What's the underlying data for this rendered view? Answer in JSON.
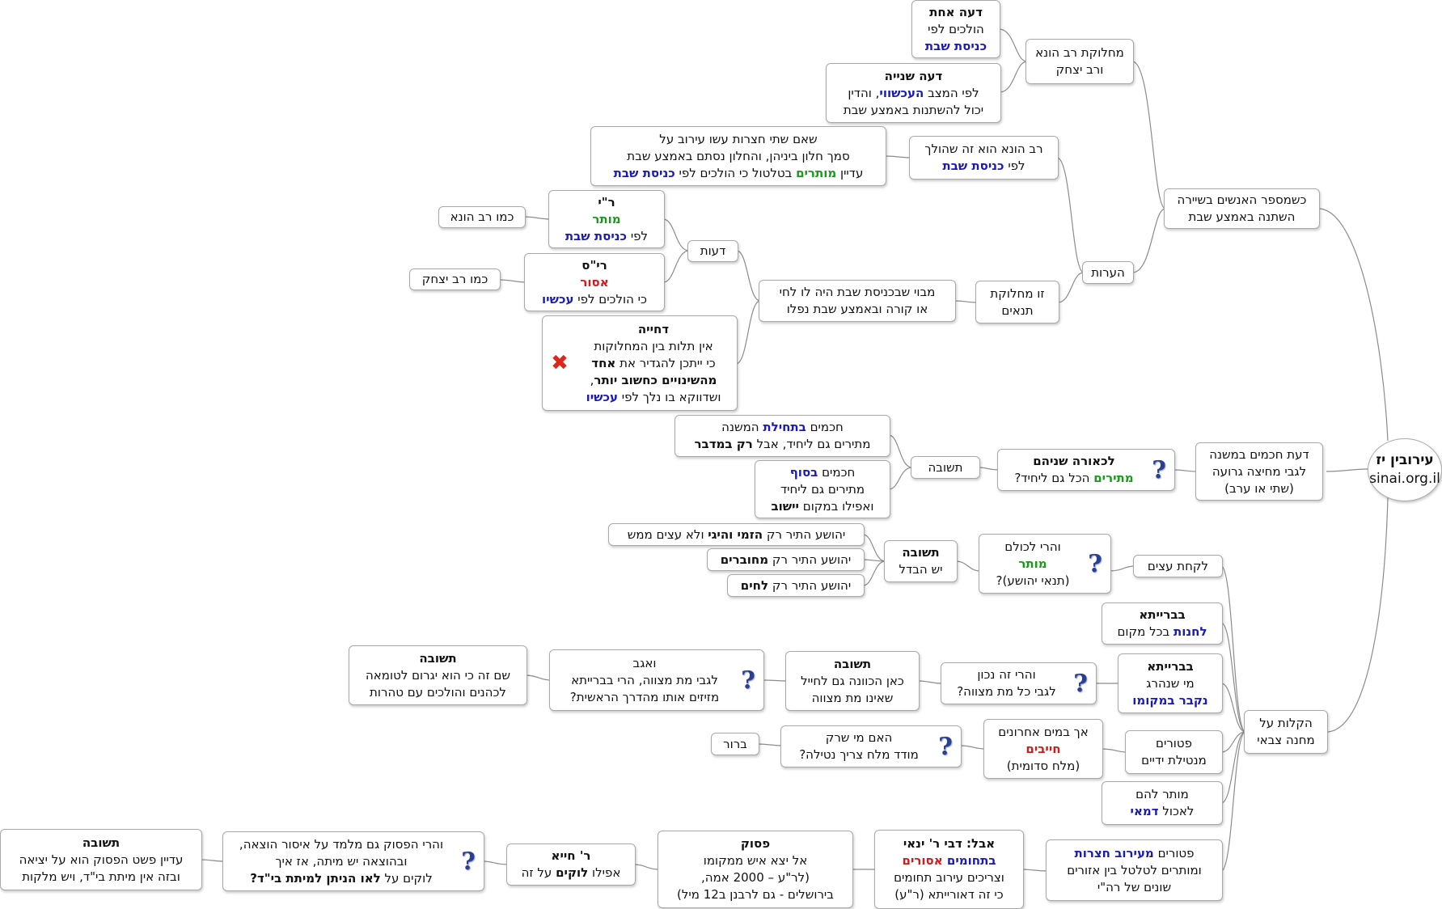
{
  "root": {
    "title": "עירובין יז",
    "site": "sinai.org.il"
  },
  "branch_change": {
    "l1": "כשמספר האנשים בשיירה",
    "l2": "השתנה באמצע שבת"
  },
  "dispute": {
    "l1": "מחלוקת רב הונא",
    "l2": "ורב יצחק"
  },
  "opinion1": {
    "title": "דעה אחת",
    "l1": "הולכים לפי",
    "l2": "כניסת שבת"
  },
  "opinion2": {
    "title": "דעה שנייה",
    "l1a": "לפי המצב ",
    "l1b": "העכשווי",
    "l1c": ", והדין",
    "l2": "יכול להשתנות באמצע שבת"
  },
  "huna": {
    "l1": "רב הונא הוא זה שהולך",
    "l2a": "לפי ",
    "l2b": "כניסת שבת"
  },
  "courtyards": {
    "l1": "שאם שתי חצרות עשו עירוב על",
    "l2": "סמך חלון ביניהן, והחלון נסתם באמצע שבת",
    "l3a": "עדיין ",
    "l3b": "מותרים",
    "l3c": "  בטלטול כי הולכים לפי ",
    "l3d": "כניסת שבת"
  },
  "notes": {
    "label": "הערות"
  },
  "tannaim": {
    "l1": "זו מחלוקת",
    "l2": "תנאים"
  },
  "alley": {
    "l1": "מבוי שבכניסת שבת היה לו לחי",
    "l2": "או קורה ובאמצע שבת נפלו"
  },
  "views": {
    "label": "דעות"
  },
  "ry": {
    "title": "ר\"י",
    "l1": "מותר",
    "l2a": "לפי ",
    "l2b": "כניסת שבת"
  },
  "like_huna": {
    "label": "כמו רב הונא"
  },
  "ris": {
    "title": "רי\"ס",
    "l1": "אסור",
    "l2a": "כי הולכים לפי ",
    "l2b": "עכשיו"
  },
  "like_yitzchak": {
    "label": "כמו רב יצחק"
  },
  "rejection": {
    "title": "דחייה",
    "l1": "אין תלות בין המחלוקות",
    "l2a": "כי ייתכן להגדיר את ",
    "l2b": "אחד",
    "l3": "מהשינויים כחשוב יותר",
    "l3c": ",",
    "l4a": "ושדווקא בו נלך לפי ",
    "l4b": "עכשיו",
    "icon": "red-x-icon"
  },
  "sages": {
    "l1": "דעת חכמים במשנה",
    "l2": "לגבי מחיצה גרועה",
    "l3": "(שתי או ערב)"
  },
  "seemingly": {
    "title": "לכאורה שניהם",
    "l1a": "מתירים",
    "l1b": " הכל גם ליחיד?",
    "icon": "question-icon"
  },
  "answer1": {
    "label": "תשובה"
  },
  "sages_start": {
    "l1a": "חכמים ",
    "l1b": "בתחילת",
    "l1c": "  המשנה",
    "l2a": "מתירים גם ליחיד, אבל ",
    "l2b": "רק במדבר"
  },
  "sages_end": {
    "l1a": "חכמים ",
    "l1b": "בסוף",
    "l2": "מתירים גם ליחיד",
    "l3a": "ואפילו במקום ",
    "l3b": "יישוב"
  },
  "wood": {
    "label": "לקחת עצים"
  },
  "allowed_all": {
    "l1": "והרי לכולם",
    "l2": "מותר",
    "l3": "(תנאי יהושע)?",
    "icon": "question-icon"
  },
  "answer2": {
    "title": "תשובה",
    "l1": "יש הבדל"
  },
  "yehoshua1": {
    "a": "יהושע התיר רק ",
    "b": "הזמי והיגי",
    "c": " ולא עצים ממש"
  },
  "yehoshua2": {
    "a": "יהושע התיר רק ",
    "b": "מחוברים"
  },
  "yehoshua3": {
    "a": "יהושע התיר רק ",
    "b": "לחים"
  },
  "leniencies": {
    "l1": "הקלות על",
    "l2": "מחנה צבאי"
  },
  "baraita1": {
    "title": "בברייתא",
    "l1a": "לחנות",
    "l1b": " בכל מקום"
  },
  "baraita2": {
    "title": "בברייתא",
    "l1": "מי שנהרג",
    "l2": "נקבר במקומו"
  },
  "met_mitzva": {
    "l1": "והרי זה נכון",
    "l2": "לגבי כל מת מצווה?",
    "icon": "question-icon"
  },
  "answer3": {
    "title": "תשובה",
    "l1": "כאן הכוונה גם לחייל",
    "l2": "שאינו מת מצווה"
  },
  "incidentally": {
    "l1": "ואגב",
    "l2": "לגבי מת מצווה, הרי בברייתא",
    "l3": "מזיזים אותו מהדרך הראשית?",
    "icon": "question-icon"
  },
  "answer4": {
    "title": "תשובה",
    "l1": "שם זה כי הוא יגרום לטומאה",
    "l2": "לכהנים והולכים עם טהרות"
  },
  "handwash": {
    "l1": "פטורים",
    "l2": "מנטילת ידיים"
  },
  "mayim": {
    "l1": "אך במים אחרונים",
    "l2": "חייבים",
    "l3": "(מלח סדומית)"
  },
  "salt": {
    "l1": "האם מי שרק",
    "l2": "מודד מלח צריך נטילה?",
    "icon": "question-icon"
  },
  "clear": {
    "label": "ברור"
  },
  "demai": {
    "l1": "מותר להם",
    "l2a": "לאכול ",
    "l2b": "דמאי"
  },
  "eruv_exempt": {
    "l1a": "פטורים ",
    "l1b": "מעירוב חצרות",
    "l2": "ומותרים לטלטל בין אזורים",
    "l3": "שונים של רה\"י"
  },
  "but_yannai": {
    "title": "אבל: דבי ר' ינאי",
    "l1a": "בתחומים",
    "l1b": " אסורים",
    "l2": "וצריכים עירוב תחומים",
    "l3": "כי זה דאורייתא (ר\"ע)"
  },
  "verse": {
    "title": "פסוק",
    "l1": "אל יצא איש ממקומו",
    "l2": "(לר\"ע – 2000 אמה,",
    "l3": "בירושלים - גם לרבנן ב12 מיל)"
  },
  "rchiya": {
    "title": "ר' חייא",
    "l1a": "אפילו ",
    "l1b": "לוקים",
    "l1c": "  על זה"
  },
  "verse_q": {
    "l1": "והרי הפסוק גם מלמד על איסור הוצאה,",
    "l2": "ובהוצאה יש מיתה,  אז איך",
    "l3a": "לוקים על ",
    "l3b": "לאו הניתן למיתת בי\"ד?",
    "icon": "question-icon"
  },
  "answer5": {
    "title": "תשובה",
    "l1": "עדיין פשט הפסוק הוא על יציאה",
    "l2": "ובזה אין מיתת בי\"ד, ויש מלקות"
  },
  "colors": {
    "link": "#8c8c8c",
    "blue": "#1a1ab8",
    "green": "#1a9a1a",
    "red": "#d11a1a",
    "border": "#a9a9a9"
  }
}
